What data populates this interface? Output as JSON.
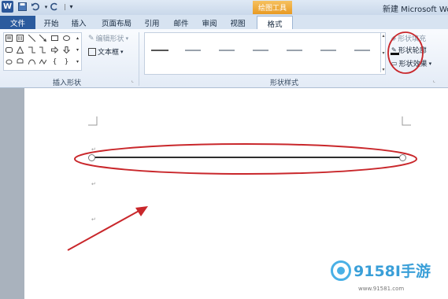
{
  "window": {
    "context_tab_title": "绘图工具",
    "doc_title": "新建 Microsoft Word"
  },
  "tabs": [
    "文件",
    "开始",
    "插入",
    "页面布局",
    "引用",
    "邮件",
    "审阅",
    "视图",
    "格式"
  ],
  "ribbon": {
    "insert_shapes": {
      "label": "插入形状",
      "edit_shape": "编辑形状",
      "text_box": "文本框"
    },
    "shape_styles": {
      "label": "形状样式",
      "fill": "形状填充",
      "outline": "形状轮廓",
      "effects": "形状效果"
    }
  },
  "watermark": {
    "text": "9158I手游",
    "url": "www.91581.com"
  },
  "colors": {
    "file_tab": "#2b5b9e",
    "context_tab": "#e89a23",
    "annotation": "#c9272b"
  }
}
